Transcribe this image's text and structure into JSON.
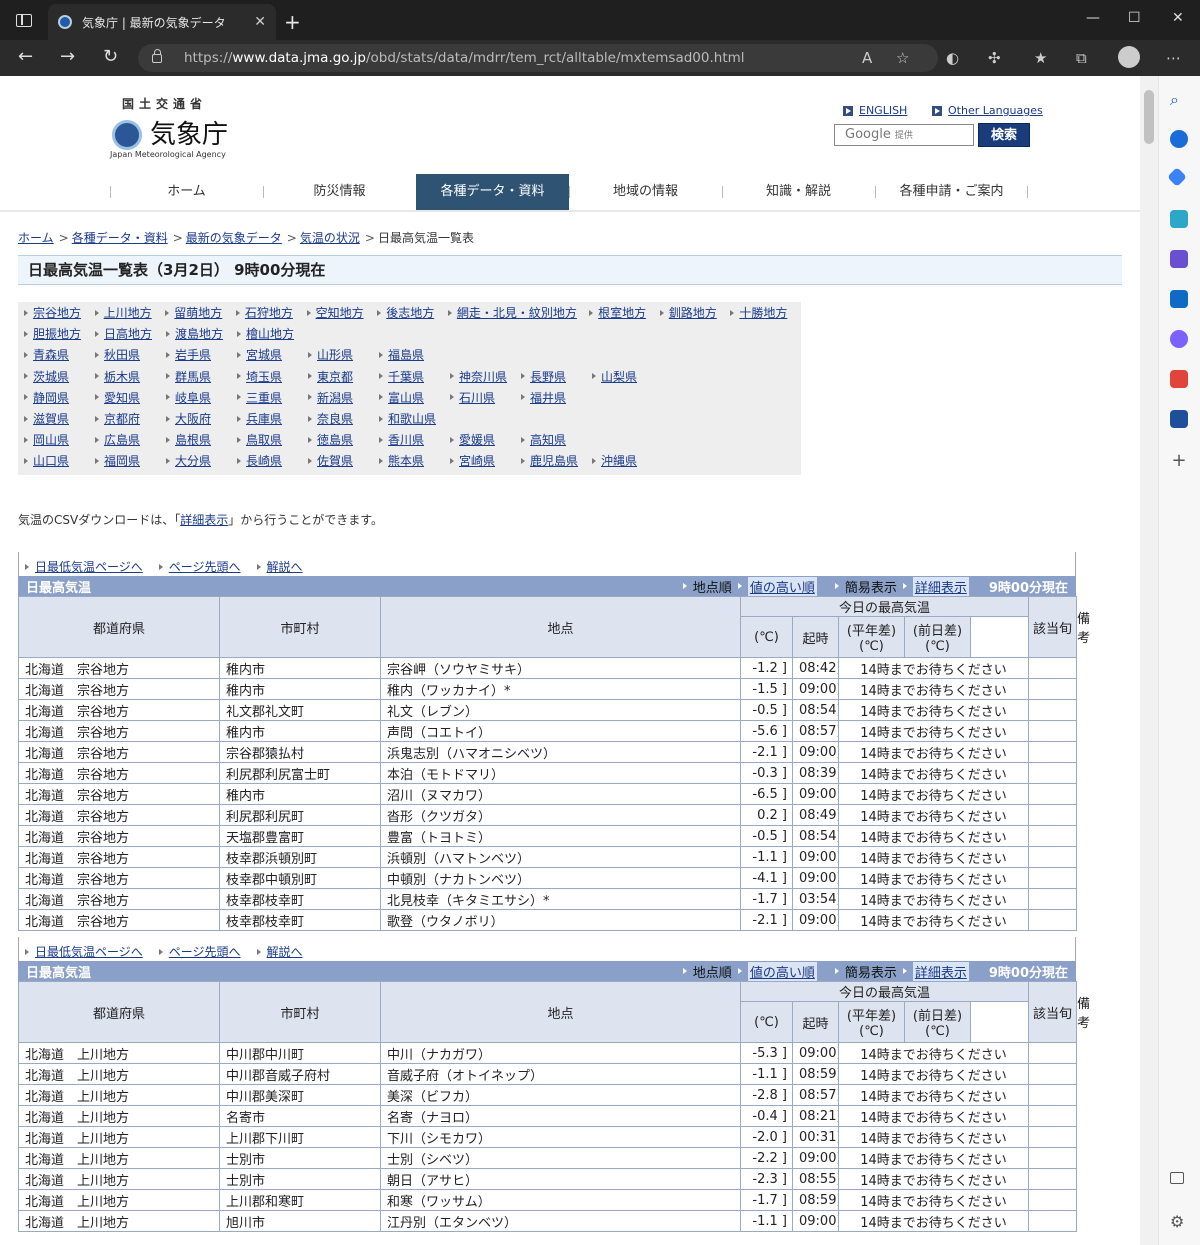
{
  "browser": {
    "tab_title": "気象庁 | 最新の気象データ",
    "url_prefix": "https://",
    "url_host": "www.data.jma.go.jp",
    "url_path": "/obd/stats/data/mdrr/tem_rct/alltable/mxtemsad00.html"
  },
  "header": {
    "logo_sub": "国土交通省",
    "logo_main": "気象庁",
    "logo_en": "Japan Meteorological Agency",
    "lang_english": "ENGLISH",
    "lang_other": "Other Languages",
    "search_placeholder": "Google",
    "search_small": "提供",
    "search_button": "検索"
  },
  "gnav": [
    "ホーム",
    "防災情報",
    "各種データ・資料",
    "地域の情報",
    "知識・解説",
    "各種申請・ご案内"
  ],
  "breadcrumb": [
    "ホーム",
    "各種データ・資料",
    "最新の気象データ",
    "気温の状況"
  ],
  "breadcrumb_current": "日最高気温一覧表",
  "page_title": "日最高気温一覧表（3月2日） 9時00分現在",
  "regions": [
    [
      "宗谷地方",
      "上川地方",
      "留萌地方",
      "石狩地方",
      "空知地方",
      "後志地方",
      "網走・北見・紋別地方",
      "根室地方",
      "釧路地方",
      "十勝地方"
    ],
    [
      "胆振地方",
      "日高地方",
      "渡島地方",
      "檜山地方"
    ],
    [
      "青森県",
      "秋田県",
      "岩手県",
      "宮城県",
      "山形県",
      "福島県"
    ],
    [
      "茨城県",
      "栃木県",
      "群馬県",
      "埼玉県",
      "東京都",
      "千葉県",
      "神奈川県",
      "長野県",
      "山梨県"
    ],
    [
      "静岡県",
      "愛知県",
      "岐阜県",
      "三重県",
      "新潟県",
      "富山県",
      "石川県",
      "福井県"
    ],
    [
      "滋賀県",
      "京都府",
      "大阪府",
      "兵庫県",
      "奈良県",
      "和歌山県"
    ],
    [
      "岡山県",
      "広島県",
      "島根県",
      "鳥取県",
      "徳島県",
      "香川県",
      "愛媛県",
      "高知県"
    ],
    [
      "山口県",
      "福岡県",
      "大分県",
      "長崎県",
      "佐賀県",
      "熊本県",
      "宮崎県",
      "鹿児島県",
      "沖縄県"
    ]
  ],
  "csv_note": {
    "before": "気温のCSVダウンロードは、「",
    "link": "詳細表示",
    "after": "」から行うことができます。"
  },
  "table_common": {
    "links": [
      "日最低気温ページへ",
      "ページ先頭へ",
      "解説へ"
    ],
    "bar_title": "日最高気温",
    "sort_label": "地点順",
    "sort_link": "値の高い順",
    "view_label": "簡易表示",
    "view_link": "詳細表示",
    "now": "9時00分現在",
    "headers": {
      "pref": "都道府県",
      "city": "市町村",
      "point": "地点",
      "group": "今日の最高気温",
      "unit": "(℃)",
      "time": "起時",
      "diff_normal": "(平年差)",
      "diff_normal_unit": "(℃)",
      "diff_prev": "(前日差)",
      "diff_prev_unit": "(℃)",
      "dekad": "該当旬",
      "note": "備考"
    },
    "wait_msg": "14時までお待ちください"
  },
  "tables": [
    {
      "rows": [
        [
          "北海道　宗谷地方",
          "稚内市",
          "宗谷岬（ソウヤミサキ）",
          "-1.2 ]",
          "08:42]"
        ],
        [
          "北海道　宗谷地方",
          "稚内市",
          "稚内（ワッカナイ）*",
          "-1.5 ]",
          "09:00]"
        ],
        [
          "北海道　宗谷地方",
          "礼文郡礼文町",
          "礼文（レブン）",
          "-0.5 ]",
          "08:54]"
        ],
        [
          "北海道　宗谷地方",
          "稚内市",
          "声問（コエトイ）",
          "-5.6 ]",
          "08:57]"
        ],
        [
          "北海道　宗谷地方",
          "宗谷郡猿払村",
          "浜鬼志別（ハマオニシベツ）",
          "-2.1 ]",
          "09:00]"
        ],
        [
          "北海道　宗谷地方",
          "利尻郡利尻富士町",
          "本泊（モトドマリ）",
          "-0.3 ]",
          "08:39]"
        ],
        [
          "北海道　宗谷地方",
          "稚内市",
          "沼川（ヌマカワ）",
          "-6.5 ]",
          "09:00]"
        ],
        [
          "北海道　宗谷地方",
          "利尻郡利尻町",
          "沓形（クツガタ）",
          "0.2 ]",
          "08:49]"
        ],
        [
          "北海道　宗谷地方",
          "天塩郡豊富町",
          "豊富（トヨトミ）",
          "-0.5 ]",
          "08:54]"
        ],
        [
          "北海道　宗谷地方",
          "枝幸郡浜頓別町",
          "浜頓別（ハマトンベツ）",
          "-1.1 ]",
          "09:00]"
        ],
        [
          "北海道　宗谷地方",
          "枝幸郡中頓別町",
          "中頓別（ナカトンベツ）",
          "-4.1 ]",
          "09:00]"
        ],
        [
          "北海道　宗谷地方",
          "枝幸郡枝幸町",
          "北見枝幸（キタミエサシ）*",
          "-1.7 ]",
          "03:54]"
        ],
        [
          "北海道　宗谷地方",
          "枝幸郡枝幸町",
          "歌登（ウタノボリ）",
          "-2.1 ]",
          "09:00]"
        ]
      ]
    },
    {
      "rows": [
        [
          "北海道　上川地方",
          "中川郡中川町",
          "中川（ナカガワ）",
          "-5.3 ]",
          "09:00]"
        ],
        [
          "北海道　上川地方",
          "中川郡音威子府村",
          "音威子府（オトイネップ）",
          "-1.1 ]",
          "08:59]"
        ],
        [
          "北海道　上川地方",
          "中川郡美深町",
          "美深（ビフカ）",
          "-2.8 ]",
          "08:57]"
        ],
        [
          "北海道　上川地方",
          "名寄市",
          "名寄（ナヨロ）",
          "-0.4 ]",
          "08:21]"
        ],
        [
          "北海道　上川地方",
          "上川郡下川町",
          "下川（シモカワ）",
          "-2.0 ]",
          "00:31]"
        ],
        [
          "北海道　上川地方",
          "士別市",
          "士別（シベツ）",
          "-2.2 ]",
          "09:00]"
        ],
        [
          "北海道　上川地方",
          "士別市",
          "朝日（アサヒ）",
          "-2.3 ]",
          "08:55]"
        ],
        [
          "北海道　上川地方",
          "上川郡和寒町",
          "和寒（ワッサム）",
          "-1.7 ]",
          "08:59]"
        ],
        [
          "北海道　上川地方",
          "旭川市",
          "江丹別（エタンベツ）",
          "-1.1 ]",
          "09:00]"
        ]
      ]
    }
  ]
}
